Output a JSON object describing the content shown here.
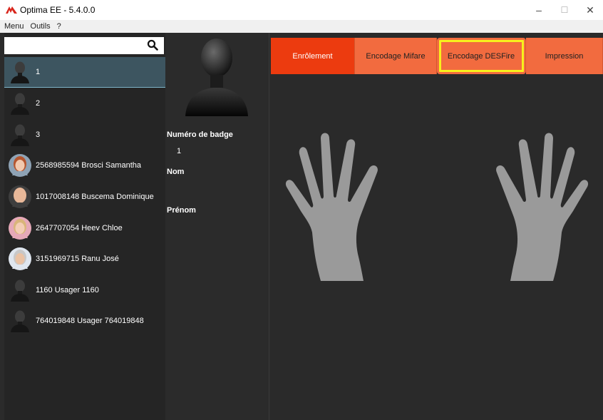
{
  "window": {
    "title": "Optima EE - 5.4.0.0",
    "minimize": "–",
    "maximize": "☐",
    "close": "✕"
  },
  "menu": {
    "items": [
      "Menu",
      "Outils",
      "?"
    ]
  },
  "search": {
    "value": "",
    "icon": "search-icon"
  },
  "users": [
    {
      "label": "1",
      "avatar": "silhouette",
      "selected": true
    },
    {
      "label": "2",
      "avatar": "silhouette"
    },
    {
      "label": "3",
      "avatar": "silhouette"
    },
    {
      "label": "2568985594   Brosci   Samantha",
      "avatar": "photo-woman-red-hair"
    },
    {
      "label": "1017008148   Buscema   Dominique",
      "avatar": "photo-man-bald"
    },
    {
      "label": "2647707054   Heev   Chloe",
      "avatar": "photo-woman-blonde"
    },
    {
      "label": "3151969715   Ranu   José",
      "avatar": "photo-man-grey"
    },
    {
      "label": "1160   Usager   1160",
      "avatar": "silhouette"
    },
    {
      "label": "764019848   Usager   764019848",
      "avatar": "silhouette"
    }
  ],
  "detail": {
    "badge_label": "Numéro de badge",
    "badge_value": "1",
    "nom_label": "Nom",
    "nom_value": "",
    "prenom_label": "Prénom",
    "prenom_value": ""
  },
  "tabs": [
    {
      "label": "Enrôlement",
      "state": "active"
    },
    {
      "label": "Encodage Mifare",
      "state": "normal"
    },
    {
      "label": "Encodage DESFire",
      "state": "highlighted"
    },
    {
      "label": "Impression",
      "state": "normal"
    }
  ],
  "colors": {
    "tab_active": "#ec3b0f",
    "tab_normal": "#f26b3f",
    "selection": "#3d5560",
    "highlight_box": "#f7f01d",
    "hand": "#9a9a9a"
  }
}
